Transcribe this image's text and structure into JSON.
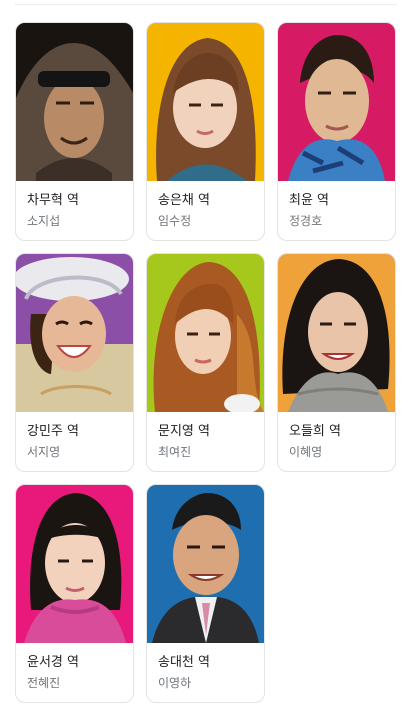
{
  "cast": [
    {
      "role": "차무혁 역",
      "actor": "소지섭",
      "photo_bg": "#7a6a5a",
      "photo_alt": "portrait of actor with black headband"
    },
    {
      "role": "송은채 역",
      "actor": "임수정",
      "photo_bg": "#f5b400",
      "photo_alt": "portrait of actress with brown hair on yellow background"
    },
    {
      "role": "최윤 역",
      "actor": "정경호",
      "photo_bg": "#d61a63",
      "photo_alt": "portrait of actor with blue scarf on pink background"
    },
    {
      "role": "강민주 역",
      "actor": "서지영",
      "photo_bg": "#8c4fa8",
      "photo_alt": "portrait of laughing actress with white hat"
    },
    {
      "role": "문지영 역",
      "actor": "최여진",
      "photo_bg": "#a6c81d",
      "photo_alt": "portrait of actress with wavy hair on green background"
    },
    {
      "role": "오들희 역",
      "actor": "이혜영",
      "photo_bg": "#f0a23a",
      "photo_alt": "portrait of actress on orange background"
    },
    {
      "role": "윤서경 역",
      "actor": "전혜진",
      "photo_bg": "#e8197a",
      "photo_alt": "portrait of actress in pink turtleneck"
    },
    {
      "role": "송대천 역",
      "actor": "이영하",
      "photo_bg": "#1f6fb0",
      "photo_alt": "portrait of actor in suit on blue background"
    }
  ]
}
